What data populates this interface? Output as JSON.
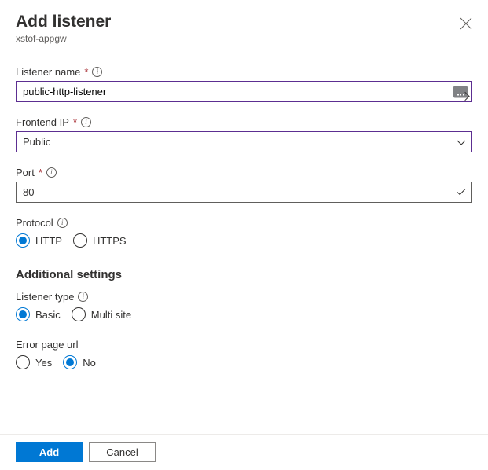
{
  "header": {
    "title": "Add listener",
    "subtitle": "xstof-appgw"
  },
  "fields": {
    "listenerName": {
      "label": "Listener name",
      "value": "public-http-listener"
    },
    "frontendIp": {
      "label": "Frontend IP",
      "value": "Public"
    },
    "port": {
      "label": "Port",
      "value": "80"
    },
    "protocol": {
      "label": "Protocol",
      "options": {
        "http": "HTTP",
        "https": "HTTPS"
      }
    }
  },
  "additional": {
    "heading": "Additional settings",
    "listenerType": {
      "label": "Listener type",
      "options": {
        "basic": "Basic",
        "multi": "Multi site"
      }
    },
    "errorPage": {
      "label": "Error page url",
      "options": {
        "yes": "Yes",
        "no": "No"
      }
    }
  },
  "footer": {
    "add": "Add",
    "cancel": "Cancel"
  }
}
